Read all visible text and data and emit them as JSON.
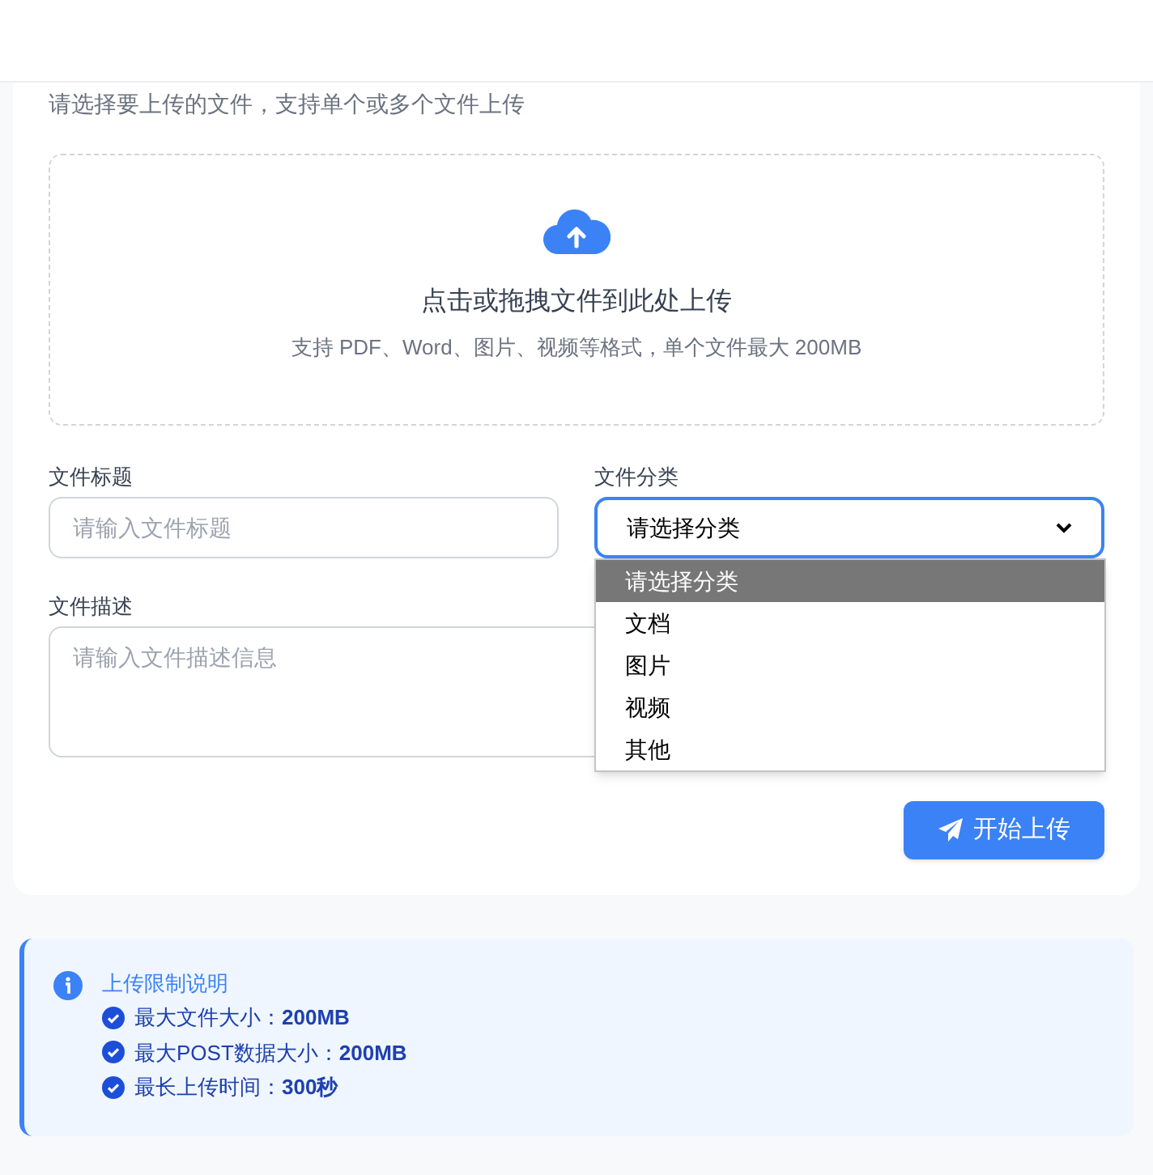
{
  "intro": "请选择要上传的文件，支持单个或多个文件上传",
  "dropzone": {
    "title": "点击或拖拽文件到此处上传",
    "hint": "支持 PDF、Word、图片、视频等格式，单个文件最大 200MB"
  },
  "title_field": {
    "label": "文件标题",
    "placeholder": "请输入文件标题"
  },
  "category_field": {
    "label": "文件分类",
    "value": "请选择分类",
    "expanded": true,
    "options": [
      {
        "label": "请选择分类",
        "selected": true
      },
      {
        "label": "文档",
        "selected": false
      },
      {
        "label": "图片",
        "selected": false
      },
      {
        "label": "视频",
        "selected": false
      },
      {
        "label": "其他",
        "selected": false
      }
    ]
  },
  "description_field": {
    "label": "文件描述",
    "placeholder": "请输入文件描述信息"
  },
  "submit_button": "开始上传",
  "notice": {
    "title": "上传限制说明",
    "items": [
      "最大文件大小：**200MB**",
      "最大POST数据大小：**200MB**",
      "最长上传时间：**300秒**"
    ]
  }
}
